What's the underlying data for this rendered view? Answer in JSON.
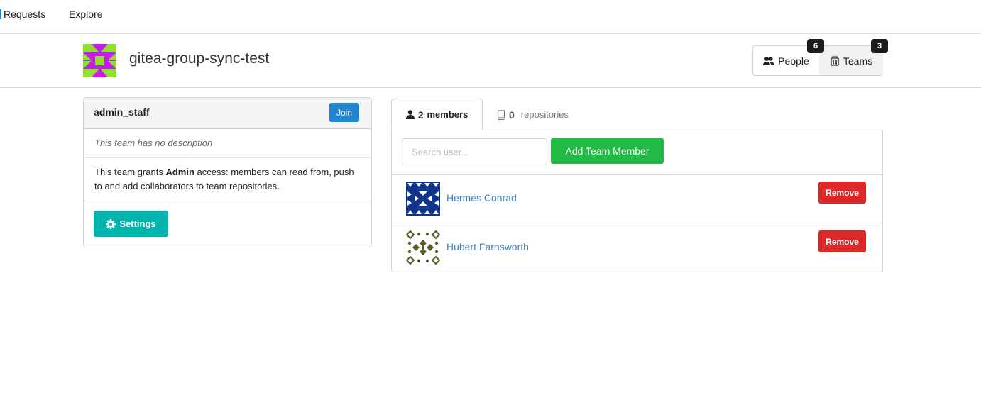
{
  "nav": {
    "items": [
      {
        "label": "Requests"
      },
      {
        "label": "Explore"
      }
    ]
  },
  "org": {
    "name": "gitea-group-sync-test",
    "people_label": "People",
    "people_count": "6",
    "teams_label": "Teams",
    "teams_count": "3"
  },
  "team": {
    "name": "admin_staff",
    "join_label": "Join",
    "description": "This team has no description",
    "grant_prefix": "This team grants",
    "grant_level": "Admin",
    "grant_suffix": "access: members can read from, push to and add collaborators to team repositories.",
    "settings_label": "Settings"
  },
  "tabs": {
    "members_count": "2",
    "members_label": "members",
    "repos_count": "0",
    "repos_label": "repositories"
  },
  "members": {
    "search_placeholder": "Search user...",
    "add_label": "Add Team Member",
    "list": [
      {
        "name": "Hermes Conrad",
        "remove_label": "Remove"
      },
      {
        "name": "Hubert Farnsworth",
        "remove_label": "Remove"
      }
    ]
  },
  "colors": {
    "primary": "#2185d0",
    "teal": "#00b5ad",
    "green": "#21ba45",
    "red": "#db2828",
    "link": "#4183c4"
  }
}
